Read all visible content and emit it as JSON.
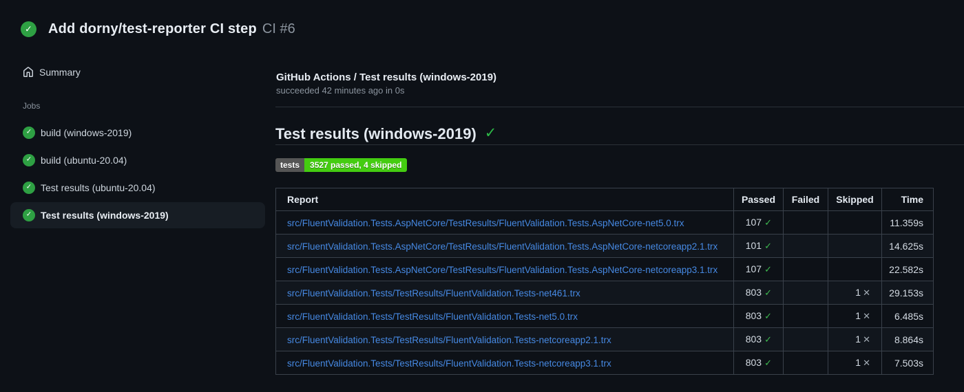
{
  "colors": {
    "page_bg": "#0d1117",
    "accent_green": "#2ea043",
    "check_green": "#3fb950",
    "link_blue": "#4689e3",
    "badge_label_bg": "#555555",
    "badge_value_bg": "#44cc11",
    "muted_text": "#8b949e"
  },
  "icons": {
    "check_glyph": "✓",
    "cross_glyph": "✕",
    "home": "home-icon",
    "status": "check-circle-icon"
  },
  "header": {
    "title": "Add dorny/test-reporter CI step",
    "run_number": "CI #6"
  },
  "sidebar": {
    "summary_label": "Summary",
    "jobs_label": "Jobs",
    "jobs": [
      {
        "label": "build (windows-2019)",
        "selected": false
      },
      {
        "label": "build (ubuntu-20.04)",
        "selected": false
      },
      {
        "label": "Test results (ubuntu-20.04)",
        "selected": false
      },
      {
        "label": "Test results (windows-2019)",
        "selected": true
      }
    ]
  },
  "main": {
    "check_title": "GitHub Actions / Test results (windows-2019)",
    "check_status": "succeeded 42 minutes ago in 0s",
    "heading": "Test results (windows-2019)",
    "badge": {
      "label": "tests",
      "value": "3527 passed, 4 skipped"
    },
    "table": {
      "headers": [
        "Report",
        "Passed",
        "Failed",
        "Skipped",
        "Time"
      ],
      "rows": [
        {
          "report": "src/FluentValidation.Tests.AspNetCore/TestResults/FluentValidation.Tests.AspNetCore-net5.0.trx",
          "passed": "107",
          "failed": "",
          "skipped": "",
          "time": "11.359s"
        },
        {
          "report": "src/FluentValidation.Tests.AspNetCore/TestResults/FluentValidation.Tests.AspNetCore-netcoreapp2.1.trx",
          "passed": "101",
          "failed": "",
          "skipped": "",
          "time": "14.625s"
        },
        {
          "report": "src/FluentValidation.Tests.AspNetCore/TestResults/FluentValidation.Tests.AspNetCore-netcoreapp3.1.trx",
          "passed": "107",
          "failed": "",
          "skipped": "",
          "time": "22.582s"
        },
        {
          "report": "src/FluentValidation.Tests/TestResults/FluentValidation.Tests-net461.trx",
          "passed": "803",
          "failed": "",
          "skipped": "1",
          "time": "29.153s"
        },
        {
          "report": "src/FluentValidation.Tests/TestResults/FluentValidation.Tests-net5.0.trx",
          "passed": "803",
          "failed": "",
          "skipped": "1",
          "time": "6.485s"
        },
        {
          "report": "src/FluentValidation.Tests/TestResults/FluentValidation.Tests-netcoreapp2.1.trx",
          "passed": "803",
          "failed": "",
          "skipped": "1",
          "time": "8.864s"
        },
        {
          "report": "src/FluentValidation.Tests/TestResults/FluentValidation.Tests-netcoreapp3.1.trx",
          "passed": "803",
          "failed": "",
          "skipped": "1",
          "time": "7.503s"
        }
      ]
    }
  }
}
